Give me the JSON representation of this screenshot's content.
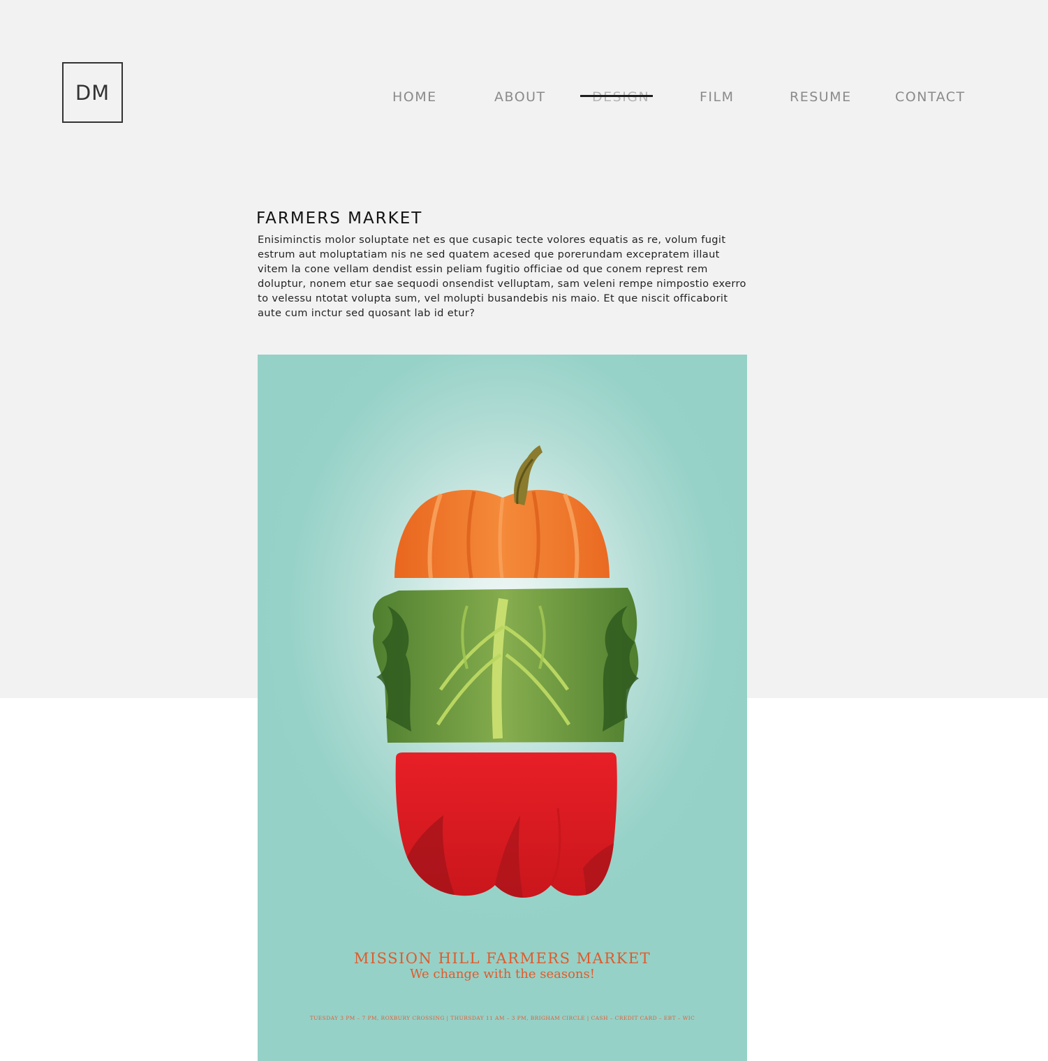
{
  "header": {
    "logo": "DM",
    "nav": [
      {
        "label": "HOME"
      },
      {
        "label": "ABOUT"
      },
      {
        "label": "DESIGN",
        "active": true
      },
      {
        "label": "FILM"
      },
      {
        "label": "RESUME"
      },
      {
        "label": "CONTACT"
      }
    ]
  },
  "project": {
    "title": "FARMERS MARKET",
    "description": "Enisiminctis molor soluptate net es que cusapic tecte volores equatis as re, volum fugit estrum aut moluptatiam nis ne sed quatem acesed que porerundam excepratem illaut vitem la cone vellam dendist essin peliam fugitio officiae od que conem represt rem doluptur, nonem etur sae sequodi onsendist velluptam, sam veleni rempe nimpos­tio exerro to velessu ntotat volupta sum, vel molupti busandebis nis maio. Et que niscit officaborit aute cum inctur sed quosant lab id etur?"
  },
  "poster": {
    "title": "MISSION HILL FARMERS MARKET",
    "tagline": "We change with the seasons!",
    "info": "TUESDAY 3 PM – 7 PM, ROXBURY CROSSING | THURSDAY 11 AM – 3 PM, BRIGHAM CIRCLE | CASH – CREDIT CARD – EBT – WIC",
    "colors": {
      "background": "#96d1c7",
      "text": "#e05a2b",
      "pumpkin": "#f07a2a",
      "lettuce": "#6e9b3f",
      "pepper": "#e31e24"
    }
  },
  "colors": {
    "page_band": "#f2f2f2",
    "nav_text": "#8a8a8a",
    "title_text": "#111111"
  }
}
